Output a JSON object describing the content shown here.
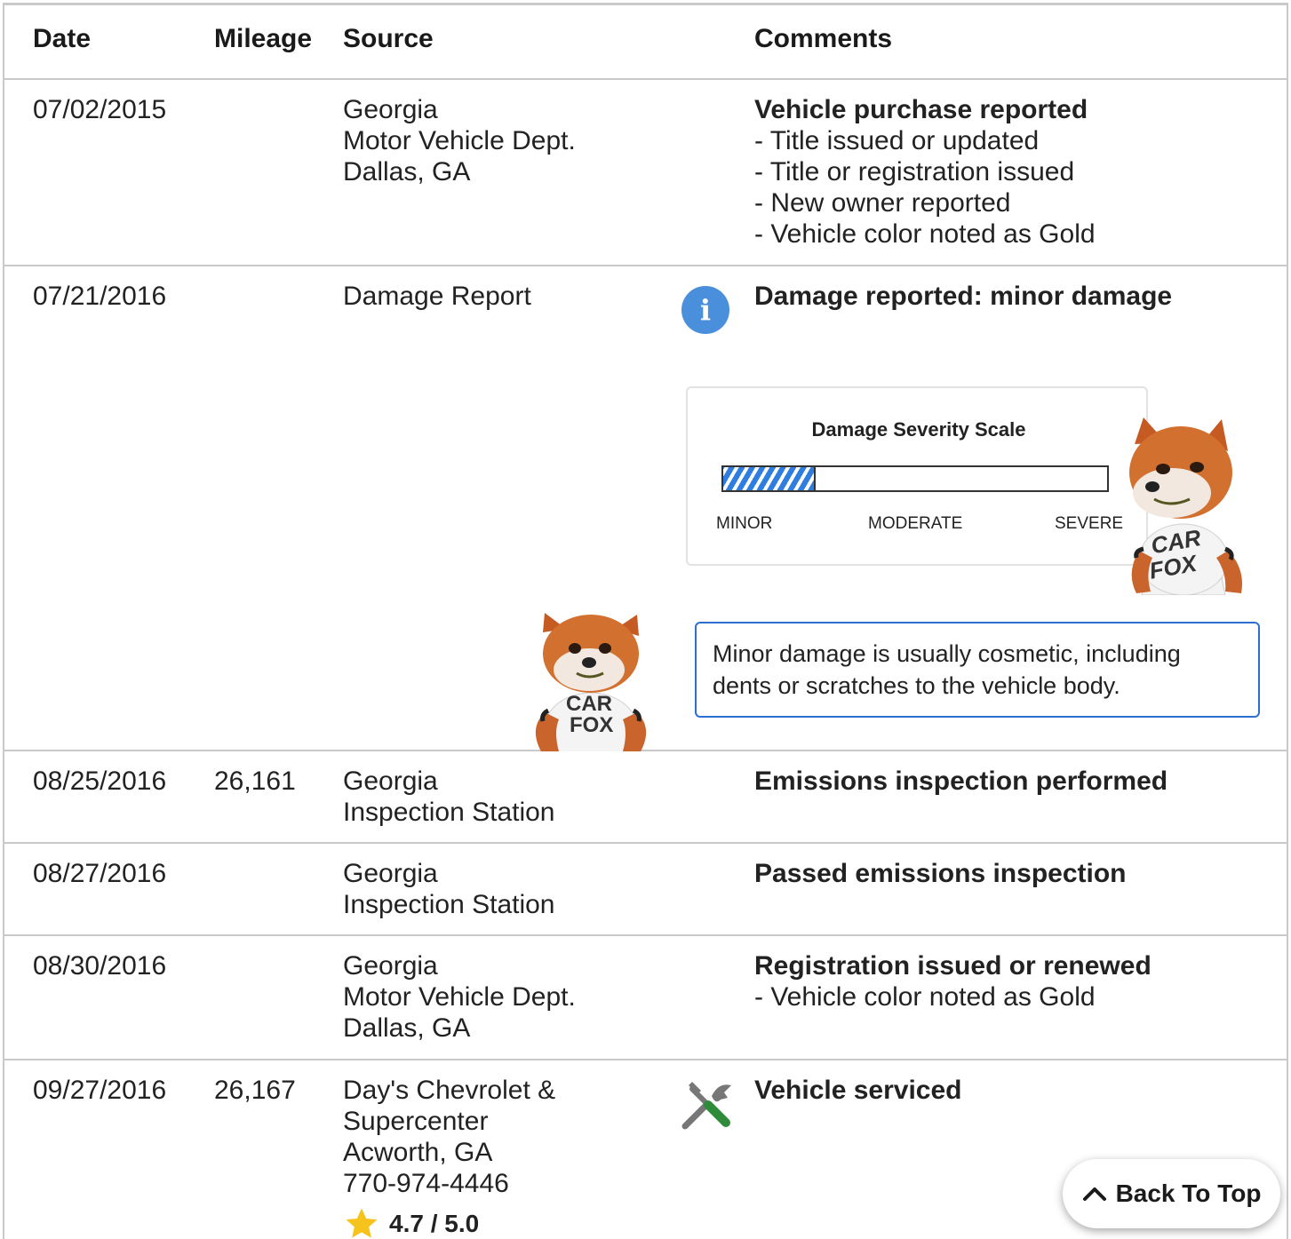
{
  "header": {
    "date": "Date",
    "mileage": "Mileage",
    "source": "Source",
    "comments": "Comments"
  },
  "records": [
    {
      "date": "07/02/2015",
      "mileage": "",
      "source": [
        "Georgia",
        "Motor Vehicle Dept.",
        "Dallas, GA"
      ],
      "title": "Vehicle purchase reported",
      "items": [
        "- Title issued or updated",
        "- Title or registration issued",
        "- New owner reported",
        "- Vehicle color noted as Gold"
      ]
    },
    {
      "date": "07/21/2016",
      "mileage": "",
      "source": [
        "Damage Report"
      ],
      "title": "Damage reported: minor damage",
      "items": []
    },
    {
      "date": "08/25/2016",
      "mileage": "26,161",
      "source": [
        "Georgia",
        "Inspection Station"
      ],
      "title": "Emissions inspection performed",
      "items": []
    },
    {
      "date": "08/27/2016",
      "mileage": "",
      "source": [
        "Georgia",
        "Inspection Station"
      ],
      "title": "Passed emissions inspection",
      "items": []
    },
    {
      "date": "08/30/2016",
      "mileage": "",
      "source": [
        "Georgia",
        "Motor Vehicle Dept.",
        "Dallas, GA"
      ],
      "title": "Registration issued or renewed",
      "items": [
        "- Vehicle color noted as Gold"
      ]
    },
    {
      "date": "09/27/2016",
      "mileage": "26,167",
      "source": [
        "Day's Chevrolet &",
        "Supercenter",
        "Acworth, GA",
        "770-974-4446"
      ],
      "title": "Vehicle serviced",
      "items": [],
      "rating": "4.7 / 5.0"
    }
  ],
  "damage_scale": {
    "title": "Damage Severity Scale",
    "labels": [
      "MINOR",
      "MODERATE",
      "SEVERE"
    ],
    "level_fraction": 0.24,
    "fill_color": "#2f7de0"
  },
  "damage_note": "Minor damage is usually cosmetic, including dents or scratches to the vehicle body.",
  "icons": {
    "info": "info-icon",
    "service": "wrench-screwdriver-icon",
    "rating": "star-icon",
    "mascot": "carfox-mascot"
  },
  "mascot_shirt_text": [
    "CAR",
    "FOX"
  ],
  "back_to_top": "Back To Top",
  "colors": {
    "accent_blue": "#2d6fd1",
    "info_blue": "#4a8fdc",
    "star_yellow": "#f6c21c",
    "divider": "#c9c9c9"
  }
}
